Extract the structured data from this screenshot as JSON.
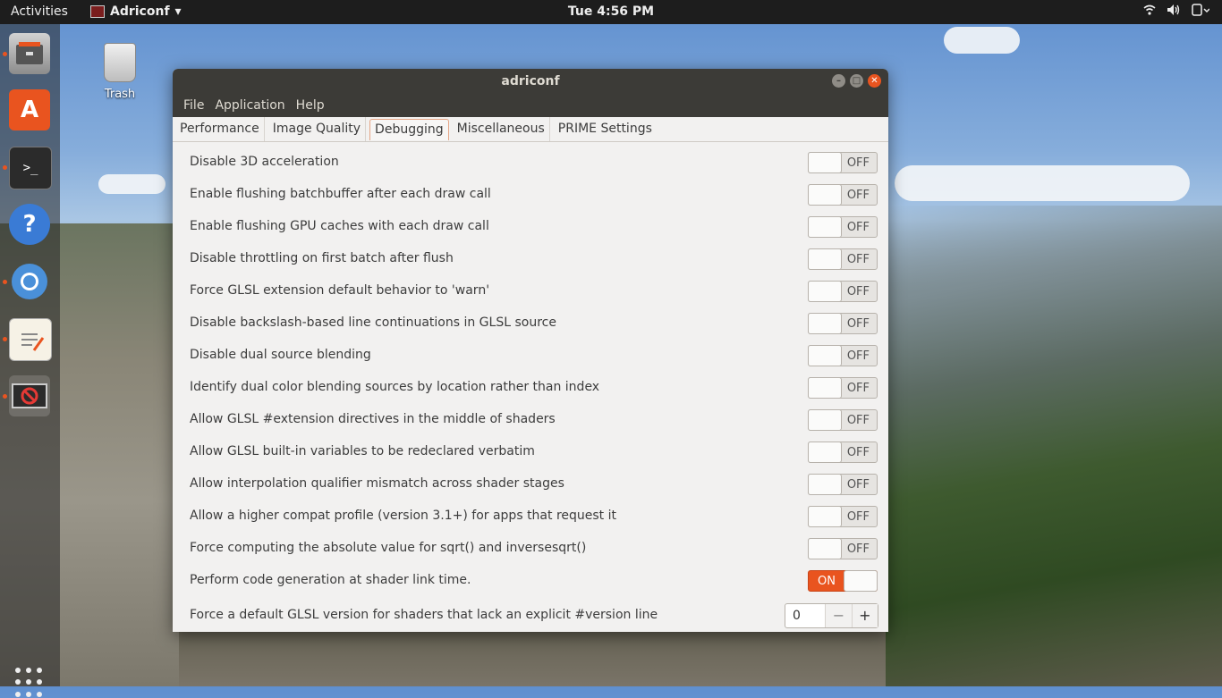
{
  "topbar": {
    "activities": "Activities",
    "app_name": "Adriconf",
    "clock": "Tue  4:56 PM",
    "tray_icons": [
      "wifi-icon",
      "volume-icon",
      "power-icon"
    ]
  },
  "desktop": {
    "trash_label": "Trash"
  },
  "dock": {
    "items": [
      "files-icon",
      "software-center-icon",
      "terminal-icon",
      "help-icon",
      "chromium-icon",
      "text-editor-icon",
      "adriconf-icon",
      "show-apps-icon"
    ]
  },
  "window": {
    "title": "adriconf",
    "menu": [
      "File",
      "Application",
      "Help"
    ],
    "tabs": [
      "Performance",
      "Image Quality",
      "Debugging",
      "Miscellaneous",
      "PRIME Settings"
    ],
    "active_tab": "Debugging",
    "options": [
      {
        "label": "Disable 3D acceleration",
        "state": "OFF"
      },
      {
        "label": "Enable flushing batchbuffer after each draw call",
        "state": "OFF"
      },
      {
        "label": "Enable flushing GPU caches with each draw call",
        "state": "OFF"
      },
      {
        "label": "Disable throttling on first batch after flush",
        "state": "OFF"
      },
      {
        "label": "Force GLSL extension default behavior to 'warn'",
        "state": "OFF"
      },
      {
        "label": "Disable backslash-based line continuations in GLSL source",
        "state": "OFF"
      },
      {
        "label": "Disable dual source blending",
        "state": "OFF"
      },
      {
        "label": "Identify dual color blending sources by location rather than index",
        "state": "OFF"
      },
      {
        "label": "Allow GLSL #extension directives in the middle of shaders",
        "state": "OFF"
      },
      {
        "label": "Allow GLSL built-in variables to be redeclared verbatim",
        "state": "OFF"
      },
      {
        "label": "Allow interpolation qualifier mismatch across shader stages",
        "state": "OFF"
      },
      {
        "label": "Allow a higher compat profile (version 3.1+) for apps that request it",
        "state": "OFF"
      },
      {
        "label": "Force computing the absolute value for sqrt() and inversesqrt()",
        "state": "OFF"
      },
      {
        "label": "Perform code generation at shader link time.",
        "state": "ON"
      }
    ],
    "glsl_version": {
      "label": "Force a default GLSL version for shaders that lack an explicit #version line",
      "value": "0",
      "minus": "−",
      "plus": "+"
    }
  },
  "colors": {
    "accent": "#e9541f",
    "titlebar": "#3c3b37",
    "window_bg": "#f2f1f0"
  }
}
